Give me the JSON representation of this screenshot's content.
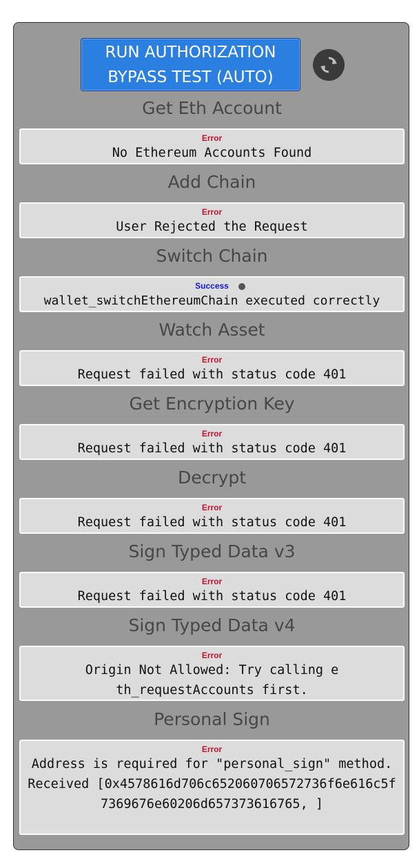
{
  "run_button": {
    "label": "RUN AUTHORIZATION BYPASS TEST (AUTO)"
  },
  "refresh": {
    "icon": "refresh-icon"
  },
  "sections": [
    {
      "title": "Get Eth Account",
      "status": "Error",
      "message": "No Ethereum Accounts Found"
    },
    {
      "title": "Add Chain",
      "status": "Error",
      "message": "User Rejected the Request"
    },
    {
      "title": "Switch Chain",
      "status": "Success",
      "message": "wallet_switchEthereumChain executed correctly"
    },
    {
      "title": "Watch Asset",
      "status": "Error",
      "message": "Request failed with status code 401"
    },
    {
      "title": "Get Encryption Key",
      "status": "Error",
      "message": "Request failed with status code 401"
    },
    {
      "title": "Decrypt",
      "status": "Error",
      "message": "Request failed with status code 401"
    },
    {
      "title": "Sign Typed Data v3",
      "status": "Error",
      "message": "Request failed with status code 401"
    },
    {
      "title": "Sign Typed Data v4",
      "status": "Error",
      "message": "Origin Not Allowed: Try calling eth_requestAccounts first."
    },
    {
      "title": "Personal Sign",
      "status": "Error",
      "message": "Address is required for \"personal_sign\" method. Received [0x4578616d706c652060706572736f6e616c5f7369676e60206d657373616765, ]"
    }
  ],
  "colors": {
    "error": "#c0132c",
    "success": "#1119d6",
    "button": "#2b7fe0",
    "panel": "#999999"
  }
}
